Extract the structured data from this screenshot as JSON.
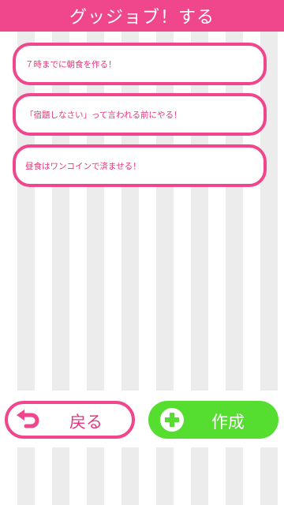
{
  "header": {
    "title": "グッジョブ！する"
  },
  "tasks": [
    {
      "text": "７時までに朝食を作る！"
    },
    {
      "text": "「宿題しなさい」って言われる前にやる！"
    },
    {
      "text": "昼食はワンコインで済ませる！"
    }
  ],
  "actions": {
    "back_label": "戻る",
    "create_label": "作成"
  },
  "colors": {
    "accent": "#f0468c",
    "text_pink": "#e8357c",
    "create_green": "#55dd2f",
    "stripe": "#ececec"
  },
  "icons": {
    "back": "return-arrow-icon",
    "create": "plus-circle-icon"
  }
}
